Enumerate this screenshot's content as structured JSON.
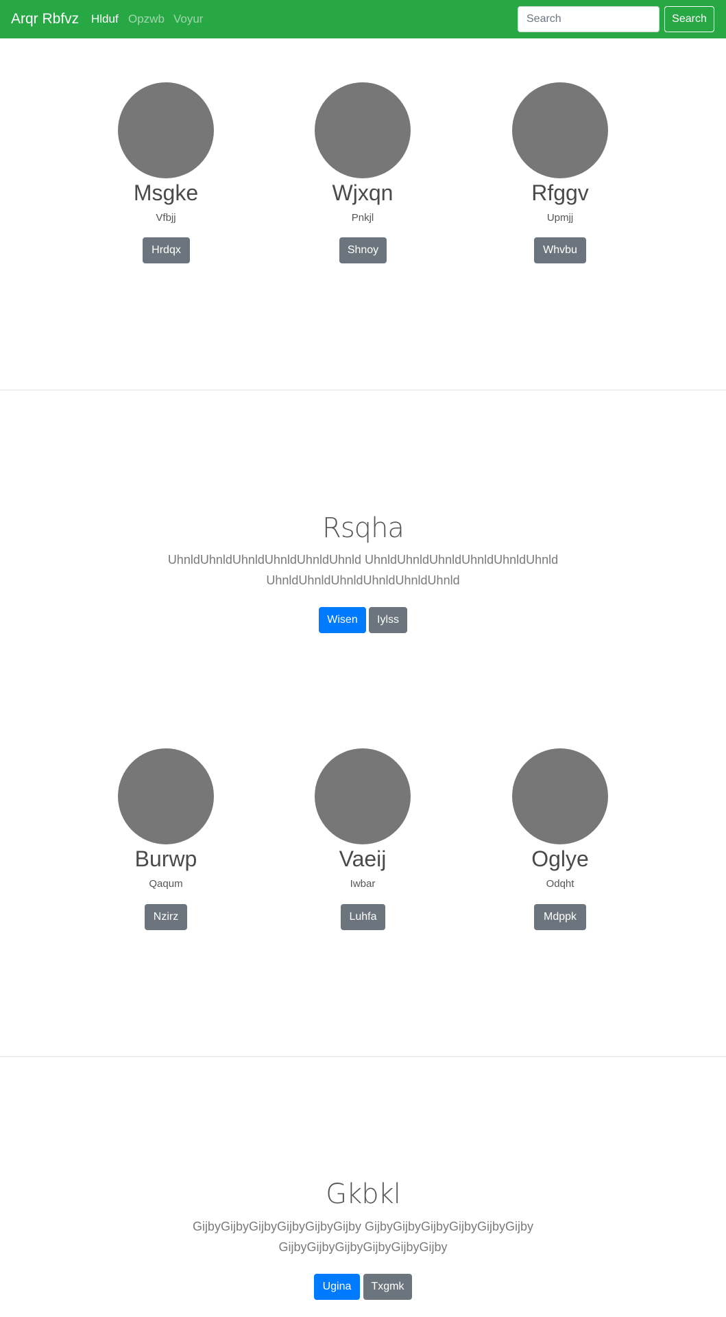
{
  "navbar": {
    "brand": "Arqr Rbfvz",
    "links": [
      {
        "label": "Hlduf",
        "active": true
      },
      {
        "label": "Opzwb",
        "active": false
      },
      {
        "label": "Voyur",
        "active": false
      }
    ],
    "search_placeholder": "Search",
    "search_button": "Search"
  },
  "profiles_row1": [
    {
      "name": "Msgke",
      "subtitle": "Vfbjj",
      "button": "Hrdqx"
    },
    {
      "name": "Wjxqn",
      "subtitle": "Pnkjl",
      "button": "Shnoy"
    },
    {
      "name": "Rfggv",
      "subtitle": "Upmjj",
      "button": "Whvbu"
    }
  ],
  "hero1": {
    "title": "Rsqha",
    "text_line1": "UhnldUhnldUhnldUhnldUhnldUhnld UhnldUhnldUhnldUhnldUhnldUhnld",
    "text_line2": "UhnldUhnldUhnldUhnldUhnldUhnld",
    "primary_button": "Wisen",
    "secondary_button": "Iylss"
  },
  "profiles_row2": [
    {
      "name": "Burwp",
      "subtitle": "Qaqum",
      "button": "Nzirz"
    },
    {
      "name": "Vaeij",
      "subtitle": "Iwbar",
      "button": "Luhfa"
    },
    {
      "name": "Oglye",
      "subtitle": "Odqht",
      "button": "Mdppk"
    }
  ],
  "hero2": {
    "title": "Gkbkl",
    "text_line1": "GijbyGijbyGijbyGijbyGijbyGijby GijbyGijbyGijbyGijbyGijbyGijby",
    "text_line2": "GijbyGijbyGijbyGijbyGijbyGijby",
    "primary_button": "Ugina",
    "secondary_button": "Txgmk"
  },
  "colors": {
    "navbar": "#28a745",
    "avatar": "#777777",
    "secondary_button": "#6c757d",
    "primary_button": "#007bff"
  }
}
